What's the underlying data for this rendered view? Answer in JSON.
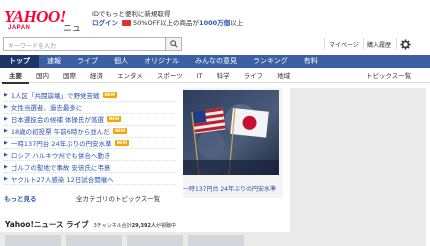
{
  "header": {
    "logo_main": "YAHOO!",
    "logo_sub": "JAPAN",
    "logo_news": "ニュース",
    "promo_line1": "IDでもっと便利に新規取得",
    "promo_login": "ログイン",
    "promo_line2_pre": "50%OFF以上の商品が",
    "promo_line2_hl": "1000万個",
    "promo_line2_post": "以上"
  },
  "search": {
    "placeholder": "キーワードを入力",
    "mypage": "マイページ",
    "account": "購入履歴"
  },
  "nav_main": [
    "トップ",
    "速報",
    "ライブ",
    "個人",
    "オリジナル",
    "みんなの意見",
    "ランキング",
    "有料"
  ],
  "nav_sub": {
    "items": [
      "主要",
      "国内",
      "国際",
      "経済",
      "エンタメ",
      "スポーツ",
      "IT",
      "科学",
      "ライフ",
      "地域"
    ],
    "right": "トピックス一覧"
  },
  "topics": [
    {
      "text": "1人区「共闘崩壊」で野党苦戦",
      "new": true
    },
    {
      "text": "女性当選者、過去最多に",
      "new": false
    },
    {
      "text": "日本選抜会の候補 体操氏が落選",
      "new": true
    },
    {
      "text": "18歳の初投票 午前6時から並んだ",
      "new": true
    },
    {
      "text": "一時137円台 24年ぶりの円安水準",
      "new": true
    },
    {
      "text": "ロシア ハルキウ州でも併合へ動き",
      "new": false
    },
    {
      "text": "ゴルフの聖地で事故 安倍氏に弔意",
      "new": false
    },
    {
      "text": "ヤクルト27人感染 12日試合開催へ",
      "new": false
    }
  ],
  "topics_new_label": "NEW",
  "more": {
    "more_link": "もっと見る",
    "all_link": "全カテゴリのトピックス一覧"
  },
  "photo_caption": "一時137円台 24年ぶりの円安水準",
  "live": {
    "title": "Yahoo!ニュース ライブ",
    "sub_pre": "3チャンネル合計",
    "count": "29,392人",
    "sub_post": "が視聴中"
  },
  "colors": {
    "nav_blue": "#3b5fa3",
    "nav_active": "#1e3567",
    "link_blue": "#2a54b0",
    "brand_red": "#ff0033"
  }
}
